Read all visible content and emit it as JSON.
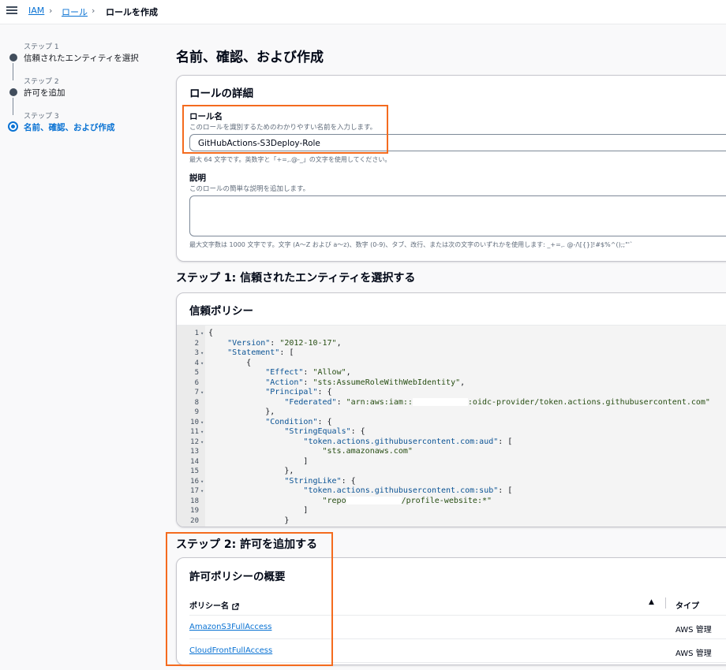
{
  "breadcrumb": {
    "items": [
      "IAM",
      "ロール"
    ],
    "current": "ロールを作成"
  },
  "steps": [
    {
      "num": "ステップ 1",
      "title": "信頼されたエンティティを選択"
    },
    {
      "num": "ステップ 2",
      "title": "許可を追加"
    },
    {
      "num": "ステップ 3",
      "title": "名前、確認、および作成"
    }
  ],
  "page_title": "名前、確認、および作成",
  "role_details": {
    "title": "ロールの詳細",
    "name_label": "ロール名",
    "name_desc": "このロールを識別するためのわかりやすい名前を入力します。",
    "name_value": "GitHubActions-S3Deploy-Role",
    "name_hint": "最大 64 文字です。英数字と「+=,.@-_」の文字を使用してください。",
    "desc_label": "説明",
    "desc_desc": "このロールの簡単な説明を追加します。",
    "desc_hint": "最大文字数は 1000 文字です。文字 (A〜Z および a〜z)、数字 (0-9)、タブ、改行、または次の文字のいずれかを使用します: _+=,. @-/\\[{}]!#$%^();;\"'`"
  },
  "step1": {
    "heading": "ステップ 1: 信頼されたエンティティを選択する",
    "card_title": "信頼ポリシー",
    "code": [
      {
        "n": "1",
        "fold": true,
        "t": "{"
      },
      {
        "n": "2",
        "fold": false,
        "t": "    \"Version\": \"2012-10-17\","
      },
      {
        "n": "3",
        "fold": true,
        "t": "    \"Statement\": ["
      },
      {
        "n": "4",
        "fold": true,
        "t": "        {"
      },
      {
        "n": "5",
        "fold": false,
        "t": "            \"Effect\": \"Allow\","
      },
      {
        "n": "6",
        "fold": false,
        "t": "            \"Action\": \"sts:AssumeRoleWithWebIdentity\","
      },
      {
        "n": "7",
        "fold": true,
        "t": "            \"Principal\": {"
      },
      {
        "n": "8",
        "fold": false,
        "t": "                \"Federated\": \"arn:aws:iam::[MASK]:oidc-provider/token.actions.githubusercontent.com\""
      },
      {
        "n": "9",
        "fold": false,
        "t": "            },"
      },
      {
        "n": "10",
        "fold": true,
        "t": "            \"Condition\": {"
      },
      {
        "n": "11",
        "fold": true,
        "t": "                \"StringEquals\": {"
      },
      {
        "n": "12",
        "fold": true,
        "t": "                    \"token.actions.githubusercontent.com:aud\": ["
      },
      {
        "n": "13",
        "fold": false,
        "t": "                        \"sts.amazonaws.com\""
      },
      {
        "n": "14",
        "fold": false,
        "t": "                    ]"
      },
      {
        "n": "15",
        "fold": false,
        "t": "                },"
      },
      {
        "n": "16",
        "fold": true,
        "t": "                \"StringLike\": {"
      },
      {
        "n": "17",
        "fold": true,
        "t": "                    \"token.actions.githubusercontent.com:sub\": ["
      },
      {
        "n": "18",
        "fold": false,
        "t": "                        \"repo[MASK]/profile-website:*\""
      },
      {
        "n": "19",
        "fold": false,
        "t": "                    ]"
      },
      {
        "n": "20",
        "fold": false,
        "t": "                }"
      }
    ]
  },
  "step2": {
    "heading": "ステップ 2: 許可を追加する",
    "card_title": "許可ポリシーの概要",
    "col_name": "ポリシー名",
    "col_type": "タイプ",
    "rows": [
      {
        "name": "AmazonS3FullAccess",
        "type": "AWS 管理"
      },
      {
        "name": "CloudFrontFullAccess",
        "type": "AWS 管理"
      }
    ]
  }
}
